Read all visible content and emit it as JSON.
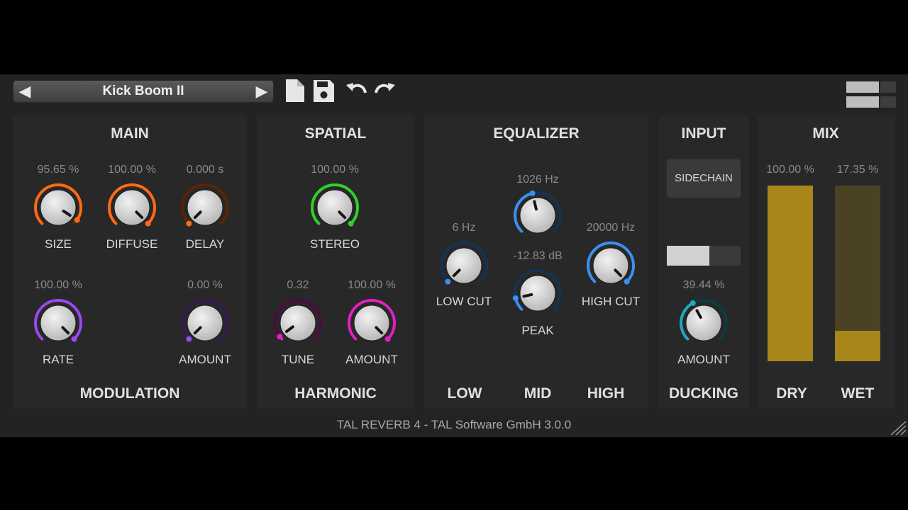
{
  "header": {
    "preset_name": "Kick Boom II",
    "prev_symbol": "◀",
    "next_symbol": "▶",
    "icons": [
      "new-preset-icon",
      "save-icon",
      "undo-icon",
      "redo-icon"
    ]
  },
  "sections": {
    "main": "MAIN",
    "spatial": "SPATIAL",
    "equalizer": "EQUALIZER",
    "input": "INPUT",
    "mix": "MIX",
    "modulation": "MODULATION",
    "harmonic": "HARMONIC",
    "ducking": "DUCKING"
  },
  "eq_bands": {
    "low": "LOW",
    "mid": "MID",
    "high": "HIGH"
  },
  "knobs": [
    {
      "id": "size",
      "label": "SIZE",
      "value": "95.65 %",
      "norm": 0.9565,
      "color": "#ff6a12"
    },
    {
      "id": "diffuse",
      "label": "DIFFUSE",
      "value": "100.00 %",
      "norm": 1.0,
      "color": "#ff6a12"
    },
    {
      "id": "delay",
      "label": "DELAY",
      "value": "0.000 s",
      "norm": 0.0,
      "color": "#ff6a12"
    },
    {
      "id": "rate",
      "label": "RATE",
      "value": "100.00 %",
      "norm": 1.0,
      "color": "#9a48f0"
    },
    {
      "id": "mod_amount",
      "label": "AMOUNT",
      "value": "0.00 %",
      "norm": 0.0,
      "color": "#9a48f0"
    },
    {
      "id": "stereo",
      "label": "STEREO",
      "value": "100.00 %",
      "norm": 1.0,
      "color": "#2fd12a"
    },
    {
      "id": "tune",
      "label": "TUNE",
      "value": "0.32",
      "norm": 0.03,
      "color": "#e020c0"
    },
    {
      "id": "harm_amount",
      "label": "AMOUNT",
      "value": "100.00 %",
      "norm": 1.0,
      "color": "#e020c0"
    },
    {
      "id": "low_cut",
      "label": "LOW CUT",
      "value": "6 Hz",
      "norm": 0.0,
      "color": "#3b8ff0"
    },
    {
      "id": "mid_freq",
      "label": "",
      "value": "1026 Hz",
      "norm": 0.45,
      "color": "#3b8ff0"
    },
    {
      "id": "peak",
      "label": "PEAK",
      "value": "-12.83 dB",
      "norm": 0.12,
      "color": "#3b8ff0"
    },
    {
      "id": "high_cut",
      "label": "HIGH CUT",
      "value": "20000 Hz",
      "norm": 1.0,
      "color": "#3b8ff0"
    },
    {
      "id": "duck_amount",
      "label": "AMOUNT",
      "value": "39.44 %",
      "norm": 0.3944,
      "color": "#20a8c0"
    }
  ],
  "input": {
    "sidechain_label": "SIDECHAIN",
    "duck_meter_level": 0.58
  },
  "mix": {
    "dry": {
      "label": "DRY",
      "value": "100.00 %",
      "level": 1.0
    },
    "wet": {
      "label": "WET",
      "value": "17.35 %",
      "level": 0.1735
    }
  },
  "footer": "TAL REVERB 4 - TAL Software GmbH 3.0.0"
}
